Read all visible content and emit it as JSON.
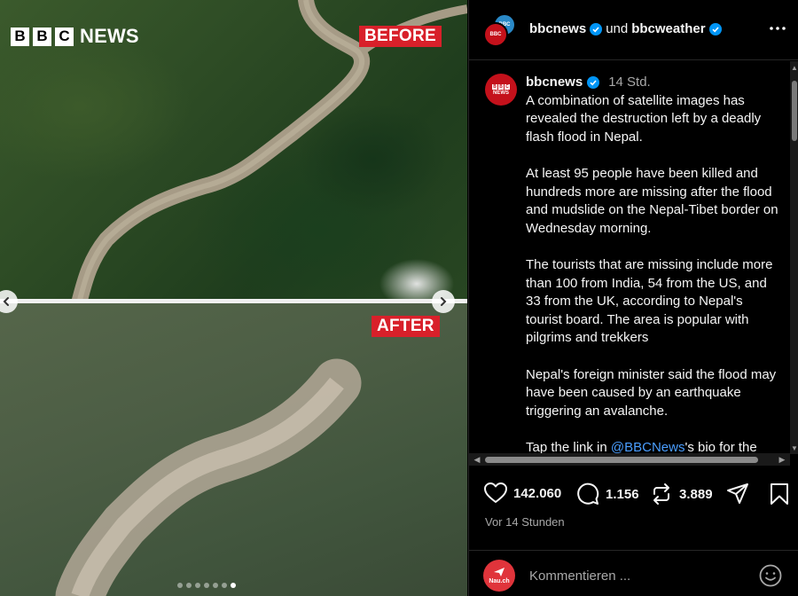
{
  "media": {
    "logo_letters": [
      "B",
      "B",
      "C"
    ],
    "logo_text": "NEWS",
    "before_label": "BEFORE",
    "after_label": "AFTER",
    "carousel_dots": 7,
    "active_dot": 6
  },
  "header": {
    "user1": "bbcnews",
    "conjunction": "und",
    "user2": "bbcweather",
    "more_icon": "more-horizontal-icon"
  },
  "post": {
    "username": "bbcnews",
    "time": "14 Std.",
    "paragraphs": [
      "A combination of satellite images has revealed the destruction left by a deadly flash flood in Nepal.",
      "At least 95 people have been killed and hundreds more are missing after the flood and mudslide on the Nepal-Tibet border on Wednesday morning.",
      "The tourists that are missing include more than 100 from India, 54 from the US, and 33 from the UK, according to Nepal's tourist board. The area is popular with pilgrims and trekkers",
      "Nepal's foreign minister said the flood may have been caused by an earthquake triggering an avalanche."
    ],
    "last_line_prefix": "Tap the link in ",
    "mention": "@BBCNews",
    "last_line_suffix": "'s bio for the"
  },
  "actions": {
    "likes": "142.060",
    "comments": "1.156",
    "reposts": "3.889"
  },
  "meta": {
    "time_ago": "Vor 14 Stunden"
  },
  "comment": {
    "avatar_text": "Nau.ch",
    "placeholder": "Kommentieren ..."
  },
  "colors": {
    "accent": "#d8202a",
    "link": "#4a9eff",
    "verified": "#0095f6",
    "background": "#000000"
  }
}
